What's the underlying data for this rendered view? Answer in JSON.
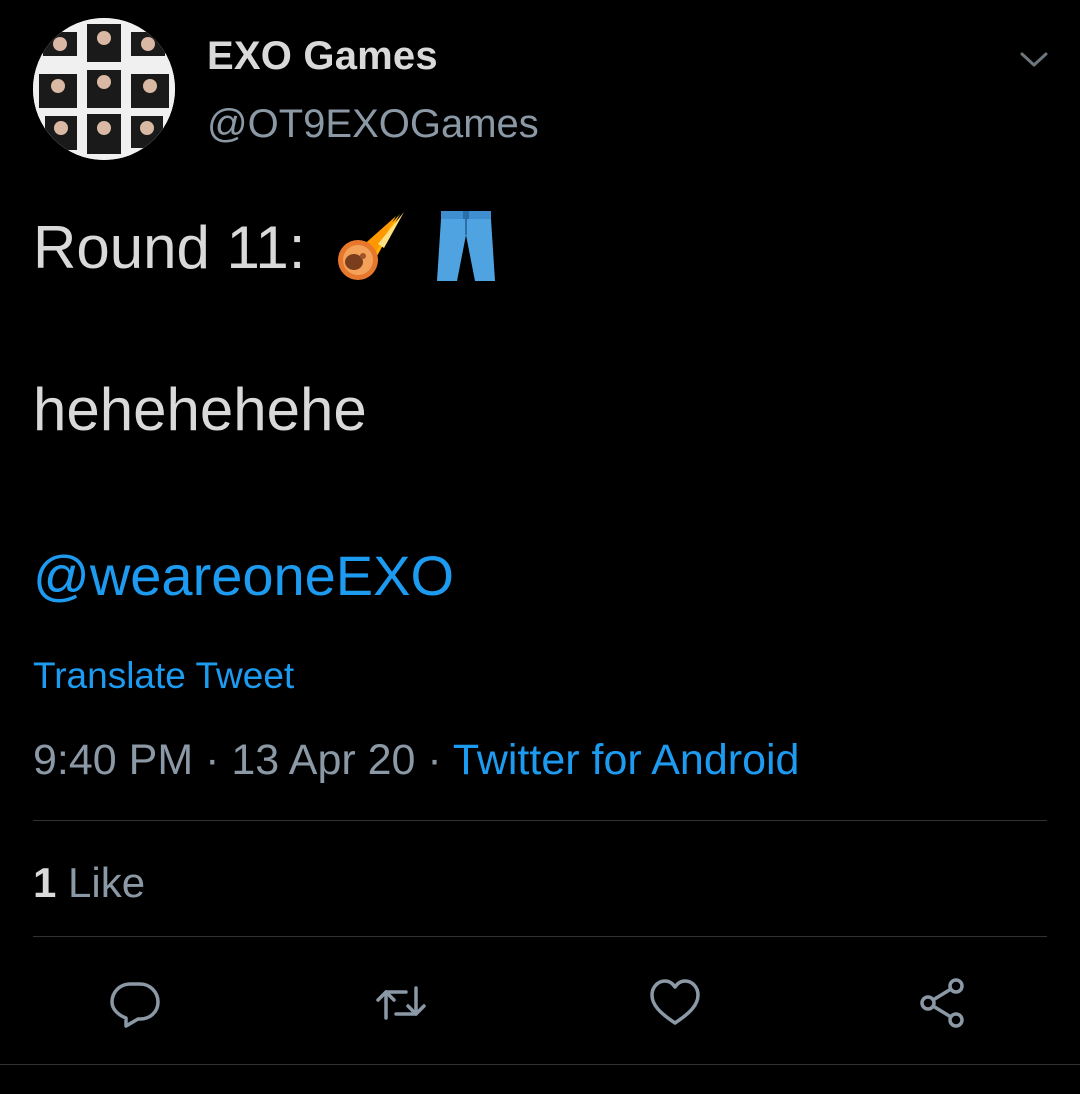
{
  "tweet": {
    "author": {
      "display_name": "EXO Games",
      "handle": "@OT9EXOGames",
      "avatar_icon": "group-photo-collage-avatar"
    },
    "text": {
      "round_label": "Round 11:",
      "emojis": [
        "comet-emoji",
        "jeans-emoji"
      ],
      "line2": "hehehehehe",
      "mention": "@weareoneEXO"
    },
    "translate_label": "Translate Tweet",
    "meta": {
      "time": "9:40 PM",
      "separator": "·",
      "date": "13 Apr 20",
      "source": "Twitter for Android"
    },
    "likes": {
      "count": "1",
      "label": "Like"
    },
    "actions": {
      "reply_icon": "reply-icon",
      "retweet_icon": "retweet-icon",
      "like_icon": "heart-icon",
      "share_icon": "share-icon"
    },
    "colors": {
      "background": "#000000",
      "primary_text": "#d9d9d9",
      "secondary_text": "#8b98a5",
      "accent": "#1d9bf0",
      "divider": "#2f3336"
    }
  }
}
